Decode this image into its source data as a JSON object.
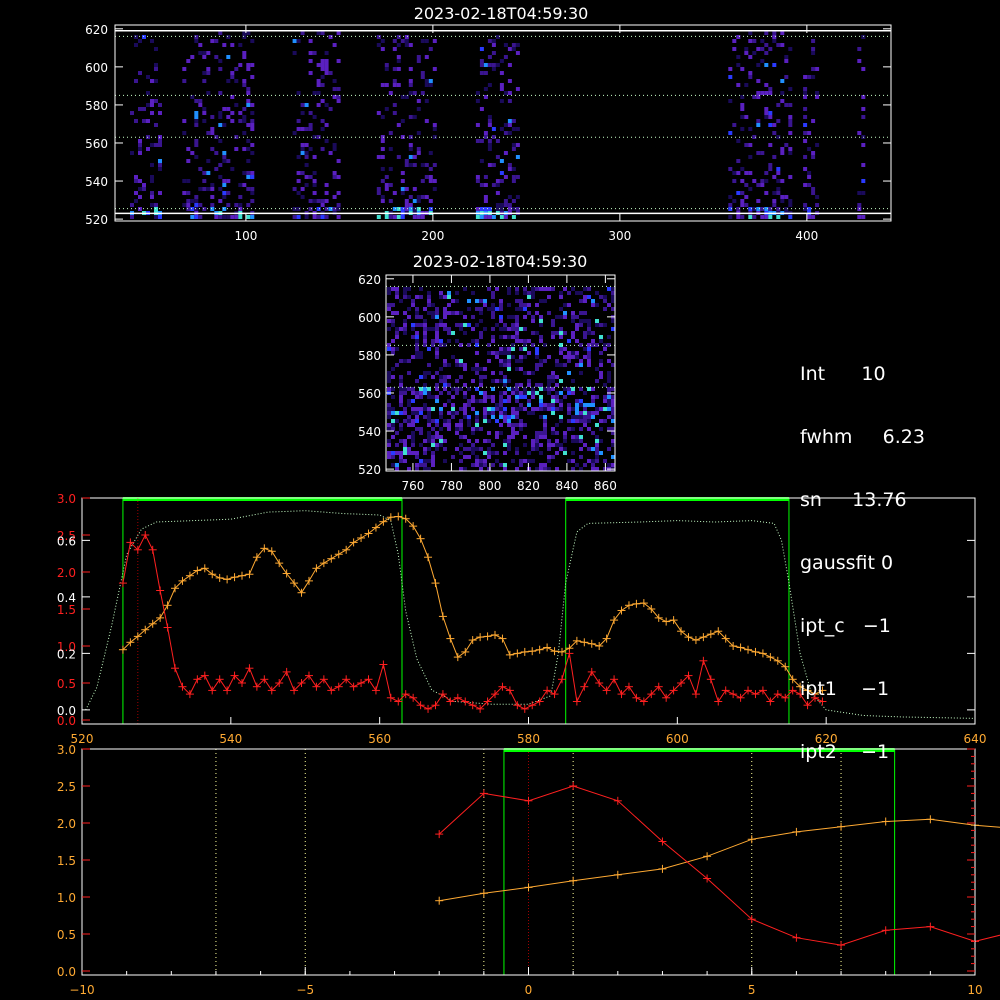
{
  "colors": {
    "white": "#ffffff",
    "red": "#ff2020",
    "orange": "#ffaa33",
    "green": "#00ff00",
    "lightgreen": "#c8ffc8",
    "yellow": "#ffff99",
    "darkred": "#a00000"
  },
  "info": {
    "lines": [
      {
        "key": "Int",
        "value": "10"
      },
      {
        "key": "fwhm",
        "value": "6.23"
      },
      {
        "key": "sn",
        "value": "13.76"
      },
      {
        "key": "gaussfit",
        "value": "0"
      },
      {
        "key": "ipt_c",
        "value": "−1"
      },
      {
        "key": "ipt1",
        "value": "−1"
      },
      {
        "key": "ipt2",
        "value": "−1"
      }
    ]
  },
  "chart_data": [
    {
      "type": "heatmap",
      "title": "2023-02-18T04:59:30",
      "xlim": [
        30,
        445
      ],
      "ylim": [
        519,
        622
      ],
      "xticks": [
        100,
        200,
        300,
        400
      ],
      "yticks": [
        520,
        540,
        560,
        580,
        600,
        620
      ],
      "guide_lines_y": [
        525.5,
        563,
        585,
        616
      ],
      "active_columns": [
        [
          38,
          53
        ],
        [
          66,
          103
        ],
        [
          125,
          150
        ],
        [
          170,
          200
        ],
        [
          223,
          245
        ],
        [
          358,
          391
        ],
        [
          398,
          405
        ],
        [
          427,
          431
        ]
      ],
      "colormap": [
        "#1a0a5a",
        "#3a1590",
        "#5a20c0",
        "#2a3aff",
        "#2090ff",
        "#40e0d0"
      ]
    },
    {
      "type": "heatmap",
      "title": "2023-02-18T04:59:30",
      "xlim": [
        746,
        865
      ],
      "ylim": [
        519,
        622
      ],
      "xticks": [
        760,
        780,
        800,
        820,
        840,
        860
      ],
      "yticks": [
        520,
        540,
        560,
        580,
        600,
        620
      ],
      "guide_lines_y": [
        563,
        585,
        616
      ],
      "colormap": [
        "#1a0a5a",
        "#3a1590",
        "#5a20c0",
        "#2a3aff",
        "#2090ff",
        "#40e0d0"
      ]
    },
    {
      "type": "line",
      "xlim": [
        520,
        640
      ],
      "xticks": [
        520,
        540,
        560,
        580,
        600,
        620,
        640
      ],
      "ylim_left": [
        0,
        3.0
      ],
      "yticks_left": [
        "0.0",
        "0.5",
        "1.0",
        "1.5",
        "2.0",
        "2.5",
        "3.0"
      ],
      "ylim_right": [
        -0.05,
        0.75
      ],
      "yticks_right": [
        "0.0",
        "0.2",
        "0.4",
        "0.6"
      ],
      "windows": [
        [
          525.5,
          563
        ],
        [
          585,
          615
        ]
      ],
      "marker_x": 527.5,
      "x": [
        525.5,
        526.5,
        527.5,
        528.5,
        529.5,
        530.5,
        531.5,
        532.5,
        533.5,
        534.5,
        535.5,
        536.5,
        537.5,
        538.5,
        539.5,
        540.5,
        541.5,
        542.5,
        543.5,
        544.5,
        545.5,
        546.5,
        547.5,
        548.5,
        549.5,
        550.5,
        551.5,
        552.5,
        553.5,
        554.5,
        555.5,
        556.5,
        557.5,
        558.5,
        559.5,
        560.5,
        561.5,
        562.5,
        563.5,
        564.5,
        565.5,
        566.5,
        567.5,
        568.5,
        569.5,
        570.5,
        571.5,
        572.5,
        573.5,
        574.5,
        575.5,
        576.5,
        577.5,
        578.5,
        579.5,
        580.5,
        581.5,
        582.5,
        583.5,
        584.5,
        585.5,
        586.5,
        587.5,
        588.5,
        589.5,
        590.5,
        591.5,
        592.5,
        593.5,
        594.5,
        595.5,
        596.5,
        597.5,
        598.5,
        599.5,
        600.5,
        601.5,
        602.5,
        603.5,
        604.5,
        605.5,
        606.5,
        607.5,
        608.5,
        609.5,
        610.5,
        611.5,
        612.5,
        613.5,
        614.5,
        615.5,
        616.5,
        617.5,
        618.5,
        619.5
      ],
      "series": [
        {
          "color": "orange",
          "values": [
            0.95,
            1.05,
            1.13,
            1.22,
            1.3,
            1.38,
            1.55,
            1.78,
            1.88,
            1.95,
            2.02,
            2.05,
            1.97,
            1.92,
            1.9,
            1.93,
            1.95,
            1.97,
            2.2,
            2.32,
            2.28,
            2.12,
            1.98,
            1.85,
            1.72,
            1.88,
            2.05,
            2.12,
            2.18,
            2.24,
            2.3,
            2.4,
            2.46,
            2.52,
            2.6,
            2.68,
            2.74,
            2.75,
            2.72,
            2.62,
            2.45,
            2.2,
            1.85,
            1.4,
            1.1,
            0.85,
            0.92,
            1.08,
            1.12,
            1.13,
            1.15,
            1.1,
            0.88,
            0.9,
            0.92,
            0.93,
            0.95,
            0.98,
            0.93,
            0.92,
            0.97,
            1.07,
            1.05,
            1.03,
            1.0,
            1.1,
            1.35,
            1.48,
            1.55,
            1.57,
            1.58,
            1.5,
            1.38,
            1.33,
            1.35,
            1.2,
            1.12,
            1.08,
            1.12,
            1.16,
            1.2,
            1.1,
            1.0,
            0.98,
            0.95,
            0.92,
            0.9,
            0.85,
            0.8,
            0.72,
            0.55,
            0.45,
            0.4,
            0.35,
            0.4
          ]
        },
        {
          "color": "red",
          "values": [
            1.85,
            2.4,
            2.3,
            2.5,
            2.3,
            1.75,
            1.25,
            0.7,
            0.45,
            0.35,
            0.55,
            0.6,
            0.4,
            0.55,
            0.4,
            0.6,
            0.5,
            0.7,
            0.45,
            0.55,
            0.4,
            0.5,
            0.65,
            0.4,
            0.5,
            0.6,
            0.45,
            0.55,
            0.4,
            0.45,
            0.55,
            0.45,
            0.5,
            0.55,
            0.4,
            0.75,
            0.3,
            0.25,
            0.35,
            0.3,
            0.2,
            0.15,
            0.2,
            0.35,
            0.25,
            0.3,
            0.25,
            0.2,
            0.15,
            0.25,
            0.35,
            0.45,
            0.4,
            0.2,
            0.15,
            0.2,
            0.25,
            0.4,
            0.35,
            0.55,
            0.9,
            0.25,
            0.45,
            0.65,
            0.5,
            0.4,
            0.55,
            0.35,
            0.45,
            0.3,
            0.25,
            0.35,
            0.45,
            0.3,
            0.4,
            0.5,
            0.6,
            0.35,
            0.8,
            0.55,
            0.25,
            0.4,
            0.35,
            0.3,
            0.4,
            0.35,
            0.4,
            0.25,
            0.35,
            0.3,
            0.4,
            0.35,
            0.2,
            0.3,
            0.25
          ]
        },
        {
          "color": "lightgreen",
          "style": "dotted",
          "axis": "right",
          "points": [
            [
              520.5,
              0.0
            ],
            [
              522,
              0.08
            ],
            [
              524,
              0.3
            ],
            [
              526,
              0.55
            ],
            [
              528,
              0.64
            ],
            [
              530,
              0.665
            ],
            [
              535,
              0.67
            ],
            [
              540,
              0.675
            ],
            [
              545,
              0.7
            ],
            [
              550,
              0.705
            ],
            [
              555,
              0.695
            ],
            [
              560,
              0.69
            ],
            [
              561.5,
              0.67
            ],
            [
              562.5,
              0.55
            ],
            [
              563.5,
              0.35
            ],
            [
              565,
              0.18
            ],
            [
              567,
              0.07
            ],
            [
              570,
              0.03
            ],
            [
              575,
              0.02
            ],
            [
              580,
              0.02
            ],
            [
              583,
              0.05
            ],
            [
              584,
              0.2
            ],
            [
              585,
              0.45
            ],
            [
              586.5,
              0.63
            ],
            [
              588,
              0.66
            ],
            [
              595,
              0.665
            ],
            [
              600,
              0.67
            ],
            [
              605,
              0.665
            ],
            [
              610,
              0.67
            ],
            [
              613,
              0.66
            ],
            [
              614,
              0.6
            ],
            [
              615,
              0.45
            ],
            [
              616.5,
              0.2
            ],
            [
              618,
              0.06
            ],
            [
              620,
              0.0
            ],
            [
              625,
              -0.02
            ],
            [
              630,
              -0.025
            ],
            [
              640,
              -0.03
            ]
          ]
        }
      ]
    },
    {
      "type": "line",
      "xlim": [
        -10,
        10
      ],
      "xticks": [
        -10,
        -5,
        0,
        5,
        10
      ],
      "ylim": [
        0,
        3.0
      ],
      "yticks": [
        "0.0",
        "0.5",
        "1.0",
        "1.5",
        "2.0",
        "2.5",
        "3.0"
      ],
      "window": [
        -0.55,
        8.2
      ],
      "marker_x": 0,
      "vlines_x": [
        -7,
        -5,
        -1,
        1,
        5,
        7
      ],
      "x_offset": -527.5,
      "x_from_panel": 3
    }
  ]
}
